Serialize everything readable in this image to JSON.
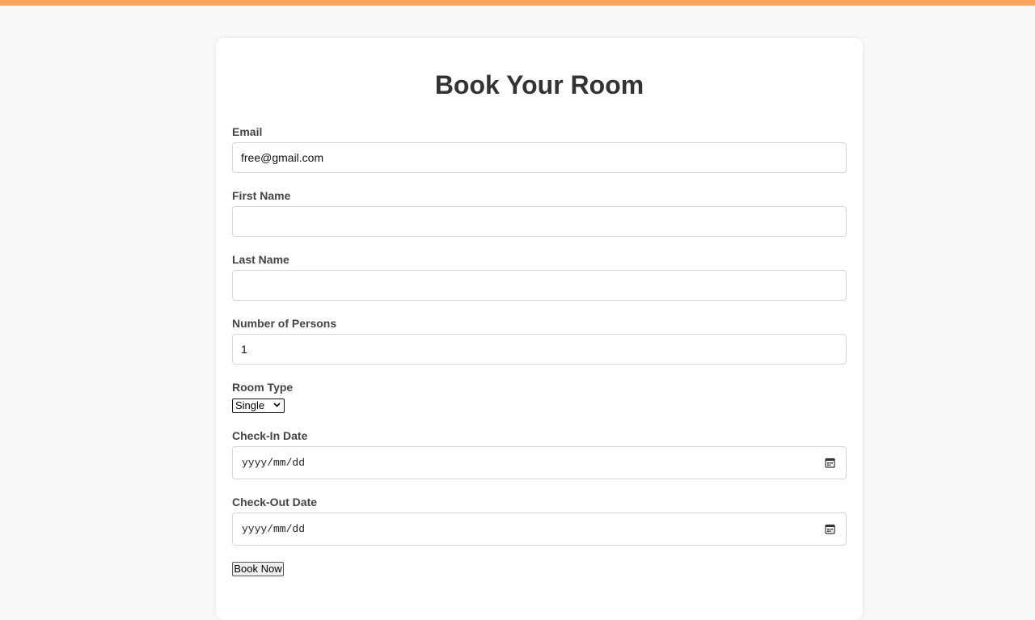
{
  "page": {
    "title": "Book Your Room",
    "accent_color": "#f8a45f"
  },
  "form": {
    "email": {
      "label": "Email",
      "value": "free@gmail.com"
    },
    "first_name": {
      "label": "First Name",
      "value": ""
    },
    "last_name": {
      "label": "Last Name",
      "value": ""
    },
    "persons": {
      "label": "Number of Persons",
      "value": "1"
    },
    "room_type": {
      "label": "Room Type",
      "selected": "Single"
    },
    "check_in": {
      "label": "Check-In Date",
      "placeholder": "yyyy/mm/dd",
      "icon": "calendar-icon"
    },
    "check_out": {
      "label": "Check-Out Date",
      "placeholder": "yyyy/mm/dd",
      "icon": "calendar-icon"
    },
    "submit_label": "Book Now"
  }
}
